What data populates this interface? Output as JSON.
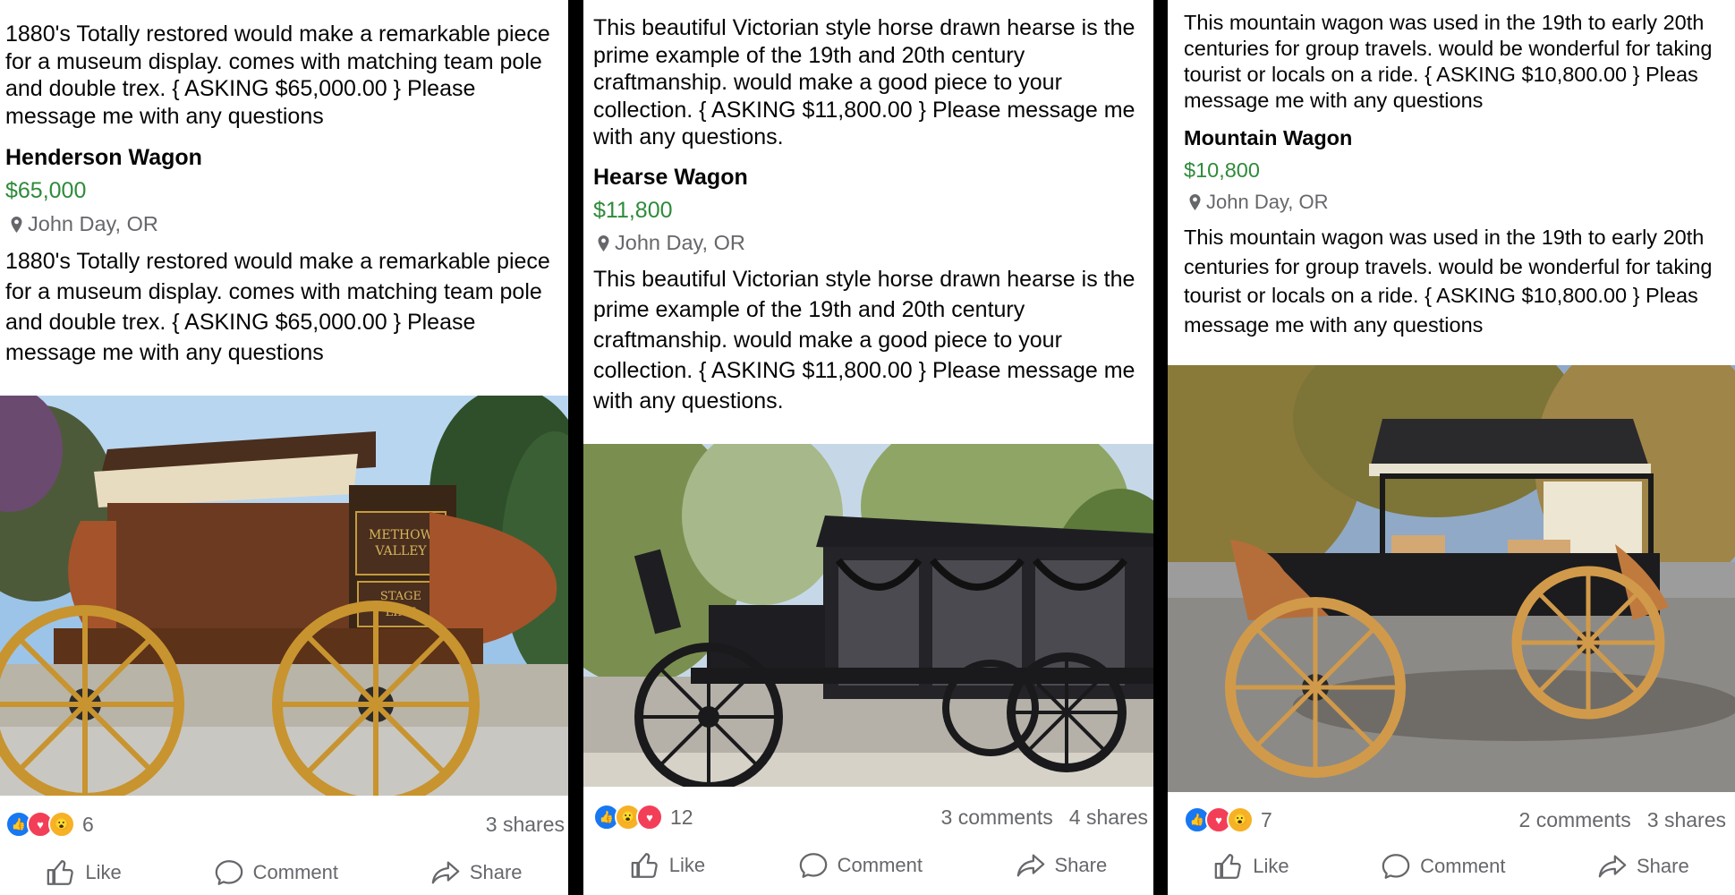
{
  "posts": [
    {
      "top_text": "1880's Totally restored would make a remarkable piece for a museum display. comes with matching team pole and double trex. { ASKING $65,000.00 } Please message me with any questions",
      "title": "Henderson Wagon",
      "price": "$65,000",
      "location": "John Day, OR",
      "description": "1880's Totally restored would make a remarkable piece for a museum display. comes with matching team pole and double trex. { ASKING $65,000.00 } Please message me with any questions",
      "photo_text_1": "METHOW",
      "photo_text_2": "VALLEY",
      "photo_text_3": "STAGE",
      "photo_text_4": "LINE",
      "reaction_count": "6",
      "comments": "",
      "shares": "3 shares"
    },
    {
      "top_text": "This beautiful Victorian style horse drawn hearse is the  prime example of the 19th and 20th century craftmanship. would make a good piece to your collection. { ASKING $11,800.00 } Please message me with any questions.",
      "title": "Hearse Wagon",
      "price": "$11,800",
      "location": "John Day, OR",
      "description": "This beautiful Victorian style horse drawn hearse is the  prime example of the 19th and 20th century craftmanship. would make a good piece to your collection. { ASKING $11,800.00 } Please message me with any questions.",
      "reaction_count": "12",
      "comments": "3 comments",
      "shares": "4 shares"
    },
    {
      "top_text": "This mountain wagon was used in the 19th to early 20th centuries for group travels. would be wonderful for taking tourist or locals on a ride. { ASKING $10,800.00 } Pleas message me with any questions",
      "title": "Mountain Wagon",
      "price": "$10,800",
      "location": "John Day, OR",
      "description": "This mountain wagon was used in the 19th to early 20th centuries for group travels. would be wonderful for taking tourist or locals on a ride. { ASKING $10,800.00 } Pleas message me with any questions",
      "reaction_count": "7",
      "comments": "2 comments",
      "shares": "3 shares"
    }
  ],
  "actions": {
    "like": "Like",
    "comment": "Comment",
    "share": "Share"
  },
  "colors": {
    "price_green": "#2e8b3a",
    "like_blue": "#1877f2",
    "love_red": "#f33e58",
    "wow_yellow": "#f7b125"
  }
}
